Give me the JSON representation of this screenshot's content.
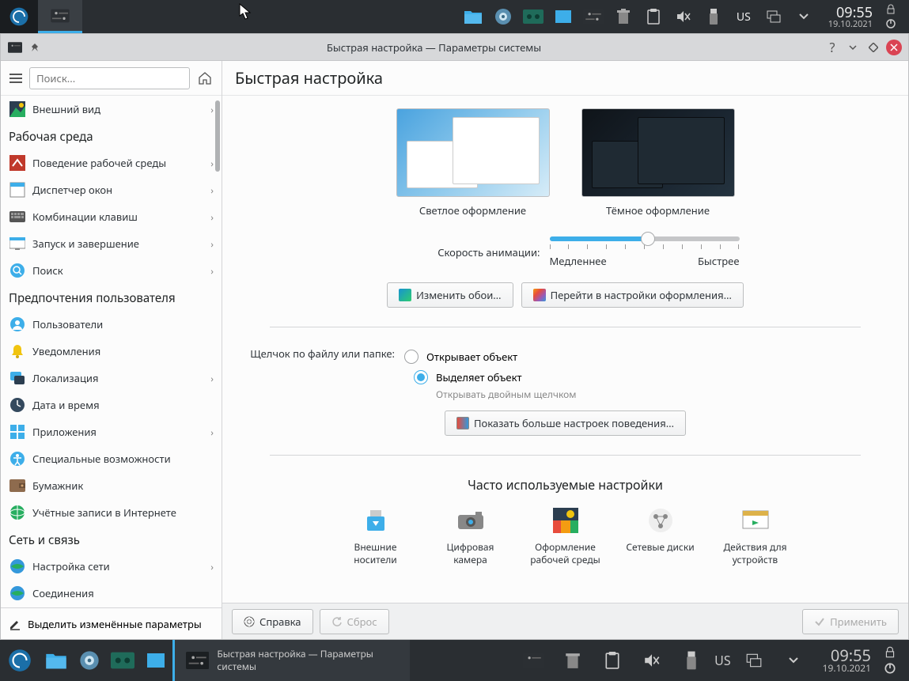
{
  "top_panel": {
    "time": "09:55",
    "date": "19.10.2021",
    "kb_layout": "US"
  },
  "bottom_panel": {
    "time": "09:55",
    "date": "19.10.2021",
    "kb_layout": "US",
    "task_title": "Быстрая настройка  — Параметры системы"
  },
  "window": {
    "title": "Быстрая настройка — Параметры системы"
  },
  "sidebar": {
    "search_placeholder": "Поиск...",
    "item_appearance": "Внешний вид",
    "cat_workspace": "Рабочая среда",
    "item_workspace_behavior": "Поведение рабочей среды",
    "item_window_mgmt": "Диспетчер окон",
    "item_shortcuts": "Комбинации клавиш",
    "item_startup": "Запуск и завершение",
    "item_search": "Поиск",
    "cat_personal": "Предпочтения пользователя",
    "item_users": "Пользователи",
    "item_notifications": "Уведомления",
    "item_locale": "Локализация",
    "item_datetime": "Дата и время",
    "item_apps": "Приложения",
    "item_accessibility": "Специальные возможности",
    "item_wallet": "Бумажник",
    "item_online_accounts": "Учётные записи в Интернете",
    "cat_network": "Сеть и связь",
    "item_network": "Настройка сети",
    "item_connections": "Соединения",
    "highlight_changed": "Выделить изменённые параметры"
  },
  "main": {
    "header": "Быстрая настройка",
    "light_theme": "Светлое оформление",
    "dark_theme": "Тёмное оформление",
    "anim_speed": "Скорость анимации:",
    "slower": "Медленнее",
    "faster": "Быстрее",
    "change_wallpaper": "Изменить обои…",
    "theme_settings": "Перейти в настройки оформления…",
    "click_label": "Щелчок по файлу или папке:",
    "opens": "Открывает объект",
    "selects": "Выделяет объект",
    "dblclick_hint": "Открывать двойным щелчком",
    "more_behavior": "Показать больше настроек поведения…",
    "frequent_title": "Часто используемые настройки",
    "freq_removable": "Внешние носители",
    "freq_camera": "Цифровая камера",
    "freq_theme": "Оформление рабочей среды",
    "freq_netdrives": "Сетевые диски",
    "freq_device_actions": "Действия для устройств"
  },
  "footer": {
    "help": "Справка",
    "reset": "Сброс",
    "apply": "Применить"
  }
}
